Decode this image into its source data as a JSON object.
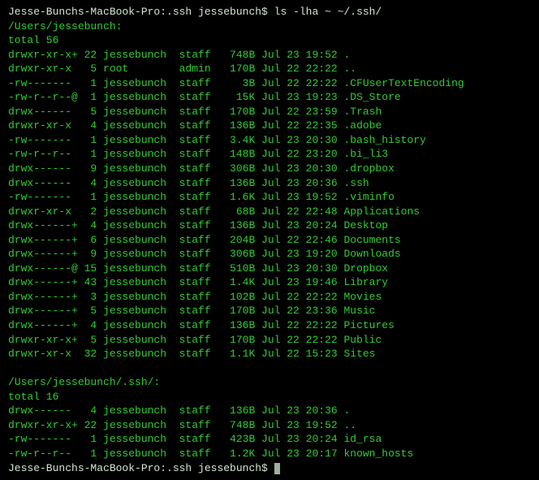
{
  "prompt1_host": "Jesse-Bunchs-MacBook-Pro:.ssh jessebunch$",
  "prompt1_cmd": " ls -lha ~ ~/.ssh/",
  "section1_header": "/Users/jessebunch:",
  "section1_total": "total 56",
  "rows1": [
    {
      "perm": "drwxr-xr-x+",
      "links": "22",
      "owner": "jessebunch",
      "group": "staff",
      "size": "748B",
      "month": "Jul",
      "day": "23",
      "time": "19:52",
      "name": "."
    },
    {
      "perm": "drwxr-xr-x",
      "links": "5",
      "owner": "root",
      "group": "admin",
      "size": "170B",
      "month": "Jul",
      "day": "22",
      "time": "22:22",
      "name": ".."
    },
    {
      "perm": "-rw-------",
      "links": "1",
      "owner": "jessebunch",
      "group": "staff",
      "size": "3B",
      "month": "Jul",
      "day": "22",
      "time": "22:22",
      "name": ".CFUserTextEncoding"
    },
    {
      "perm": "-rw-r--r--@",
      "links": "1",
      "owner": "jessebunch",
      "group": "staff",
      "size": "15K",
      "month": "Jul",
      "day": "23",
      "time": "19:23",
      "name": ".DS_Store"
    },
    {
      "perm": "drwx------",
      "links": "5",
      "owner": "jessebunch",
      "group": "staff",
      "size": "170B",
      "month": "Jul",
      "day": "22",
      "time": "23:59",
      "name": ".Trash"
    },
    {
      "perm": "drwxr-xr-x",
      "links": "4",
      "owner": "jessebunch",
      "group": "staff",
      "size": "136B",
      "month": "Jul",
      "day": "22",
      "time": "22:35",
      "name": ".adobe"
    },
    {
      "perm": "-rw-------",
      "links": "1",
      "owner": "jessebunch",
      "group": "staff",
      "size": "3.4K",
      "month": "Jul",
      "day": "23",
      "time": "20:30",
      "name": ".bash_history"
    },
    {
      "perm": "-rw-r--r--",
      "links": "1",
      "owner": "jessebunch",
      "group": "staff",
      "size": "148B",
      "month": "Jul",
      "day": "22",
      "time": "23:20",
      "name": ".bi_li3"
    },
    {
      "perm": "drwx------",
      "links": "9",
      "owner": "jessebunch",
      "group": "staff",
      "size": "306B",
      "month": "Jul",
      "day": "23",
      "time": "20:30",
      "name": ".dropbox"
    },
    {
      "perm": "drwx------",
      "links": "4",
      "owner": "jessebunch",
      "group": "staff",
      "size": "136B",
      "month": "Jul",
      "day": "23",
      "time": "20:36",
      "name": ".ssh"
    },
    {
      "perm": "-rw-------",
      "links": "1",
      "owner": "jessebunch",
      "group": "staff",
      "size": "1.6K",
      "month": "Jul",
      "day": "23",
      "time": "19:52",
      "name": ".viminfo"
    },
    {
      "perm": "drwxr-xr-x",
      "links": "2",
      "owner": "jessebunch",
      "group": "staff",
      "size": "68B",
      "month": "Jul",
      "day": "22",
      "time": "22:48",
      "name": "Applications"
    },
    {
      "perm": "drwx------+",
      "links": "4",
      "owner": "jessebunch",
      "group": "staff",
      "size": "136B",
      "month": "Jul",
      "day": "23",
      "time": "20:24",
      "name": "Desktop"
    },
    {
      "perm": "drwx------+",
      "links": "6",
      "owner": "jessebunch",
      "group": "staff",
      "size": "204B",
      "month": "Jul",
      "day": "22",
      "time": "22:46",
      "name": "Documents"
    },
    {
      "perm": "drwx------+",
      "links": "9",
      "owner": "jessebunch",
      "group": "staff",
      "size": "306B",
      "month": "Jul",
      "day": "23",
      "time": "19:20",
      "name": "Downloads"
    },
    {
      "perm": "drwx------@",
      "links": "15",
      "owner": "jessebunch",
      "group": "staff",
      "size": "510B",
      "month": "Jul",
      "day": "23",
      "time": "20:30",
      "name": "Dropbox"
    },
    {
      "perm": "drwx------+",
      "links": "43",
      "owner": "jessebunch",
      "group": "staff",
      "size": "1.4K",
      "month": "Jul",
      "day": "23",
      "time": "19:46",
      "name": "Library"
    },
    {
      "perm": "drwx------+",
      "links": "3",
      "owner": "jessebunch",
      "group": "staff",
      "size": "102B",
      "month": "Jul",
      "day": "22",
      "time": "22:22",
      "name": "Movies"
    },
    {
      "perm": "drwx------+",
      "links": "5",
      "owner": "jessebunch",
      "group": "staff",
      "size": "170B",
      "month": "Jul",
      "day": "22",
      "time": "23:36",
      "name": "Music"
    },
    {
      "perm": "drwx------+",
      "links": "4",
      "owner": "jessebunch",
      "group": "staff",
      "size": "136B",
      "month": "Jul",
      "day": "22",
      "time": "22:22",
      "name": "Pictures"
    },
    {
      "perm": "drwxr-xr-x+",
      "links": "5",
      "owner": "jessebunch",
      "group": "staff",
      "size": "170B",
      "month": "Jul",
      "day": "22",
      "time": "22:22",
      "name": "Public"
    },
    {
      "perm": "drwxr-xr-x",
      "links": "32",
      "owner": "jessebunch",
      "group": "staff",
      "size": "1.1K",
      "month": "Jul",
      "day": "22",
      "time": "15:23",
      "name": "Sites"
    }
  ],
  "section2_header": "/Users/jessebunch/.ssh/:",
  "section2_total": "total 16",
  "rows2": [
    {
      "perm": "drwx------",
      "links": "4",
      "owner": "jessebunch",
      "group": "staff",
      "size": "136B",
      "month": "Jul",
      "day": "23",
      "time": "20:36",
      "name": "."
    },
    {
      "perm": "drwxr-xr-x+",
      "links": "22",
      "owner": "jessebunch",
      "group": "staff",
      "size": "748B",
      "month": "Jul",
      "day": "23",
      "time": "19:52",
      "name": ".."
    },
    {
      "perm": "-rw-------",
      "links": "1",
      "owner": "jessebunch",
      "group": "staff",
      "size": "423B",
      "month": "Jul",
      "day": "23",
      "time": "20:24",
      "name": "id_rsa"
    },
    {
      "perm": "-rw-r--r--",
      "links": "1",
      "owner": "jessebunch",
      "group": "staff",
      "size": "1.2K",
      "month": "Jul",
      "day": "23",
      "time": "20:17",
      "name": "known_hosts"
    }
  ],
  "prompt2_host": "Jesse-Bunchs-MacBook-Pro:.ssh jessebunch$",
  "prompt2_cmd": " "
}
